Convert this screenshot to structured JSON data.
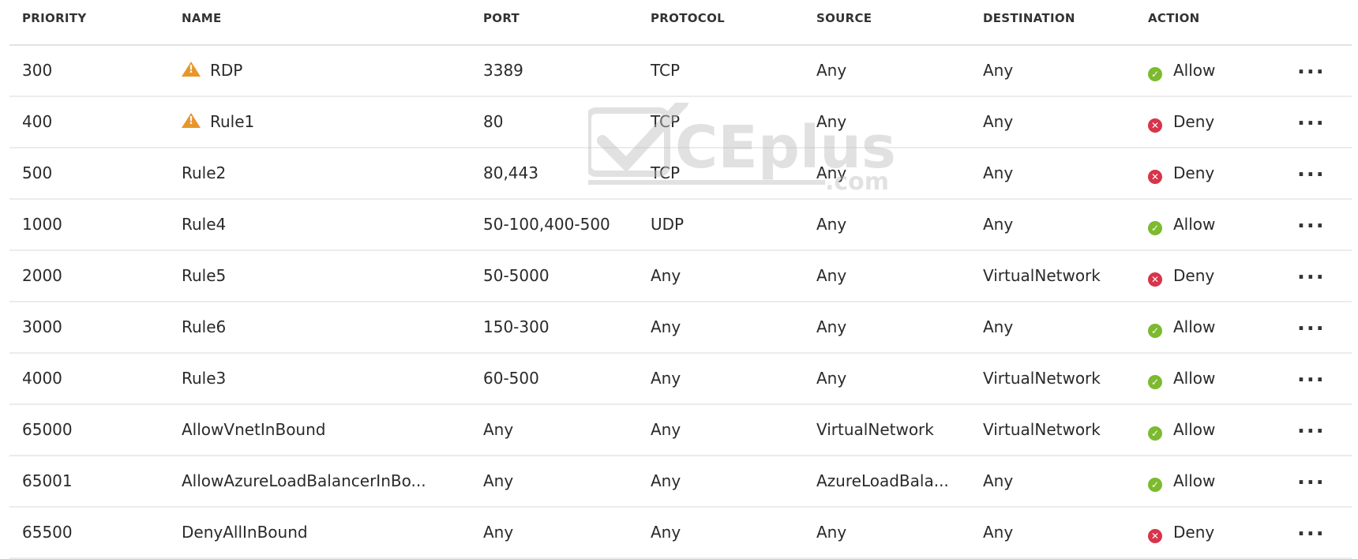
{
  "columns": {
    "priority": "PRIORITY",
    "name": "NAME",
    "port": "PORT",
    "protocol": "PROTOCOL",
    "source": "SOURCE",
    "destination": "DESTINATION",
    "action": "ACTION"
  },
  "rows": [
    {
      "priority": "300",
      "name": "RDP",
      "warning": true,
      "port": "3389",
      "protocol": "TCP",
      "source": "Any",
      "destination": "Any",
      "action": "Allow"
    },
    {
      "priority": "400",
      "name": "Rule1",
      "warning": true,
      "port": "80",
      "protocol": "TCP",
      "source": "Any",
      "destination": "Any",
      "action": "Deny"
    },
    {
      "priority": "500",
      "name": "Rule2",
      "warning": false,
      "port": "80,443",
      "protocol": "TCP",
      "source": "Any",
      "destination": "Any",
      "action": "Deny"
    },
    {
      "priority": "1000",
      "name": "Rule4",
      "warning": false,
      "port": "50-100,400-500",
      "protocol": "UDP",
      "source": "Any",
      "destination": "Any",
      "action": "Allow"
    },
    {
      "priority": "2000",
      "name": "Rule5",
      "warning": false,
      "port": "50-5000",
      "protocol": "Any",
      "source": "Any",
      "destination": "VirtualNetwork",
      "action": "Deny"
    },
    {
      "priority": "3000",
      "name": "Rule6",
      "warning": false,
      "port": "150-300",
      "protocol": "Any",
      "source": "Any",
      "destination": "Any",
      "action": "Allow"
    },
    {
      "priority": "4000",
      "name": "Rule3",
      "warning": false,
      "port": "60-500",
      "protocol": "Any",
      "source": "Any",
      "destination": "VirtualNetwork",
      "action": "Allow"
    },
    {
      "priority": "65000",
      "name": "AllowVnetInBound",
      "warning": false,
      "port": "Any",
      "protocol": "Any",
      "source": "VirtualNetwork",
      "destination": "VirtualNetwork",
      "action": "Allow"
    },
    {
      "priority": "65001",
      "name": "AllowAzureLoadBalancerInBo...",
      "warning": false,
      "port": "Any",
      "protocol": "Any",
      "source": "AzureLoadBala...",
      "destination": "Any",
      "action": "Allow"
    },
    {
      "priority": "65500",
      "name": "DenyAllInBound",
      "warning": false,
      "port": "Any",
      "protocol": "Any",
      "source": "Any",
      "destination": "Any",
      "action": "Deny"
    }
  ],
  "more_label": "...",
  "icons": {
    "warning": "warning-icon",
    "allow": "allow-status-icon",
    "deny": "deny-status-icon",
    "more": "more-options-icon"
  },
  "colors": {
    "allow": "#7cba2f",
    "deny": "#d8344a",
    "warning": "#e8962a"
  },
  "watermark": {
    "brand": "CEplus",
    "suffix": ".com"
  }
}
